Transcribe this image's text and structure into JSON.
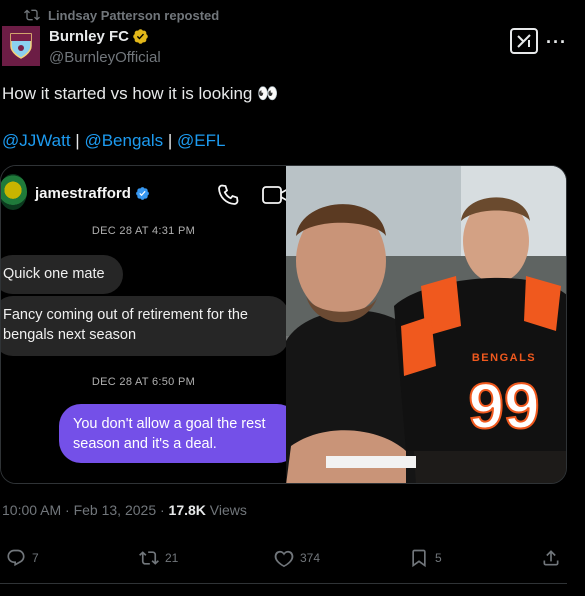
{
  "repost": {
    "text": "Lindsay Patterson reposted"
  },
  "author": {
    "name": "Burnley FC",
    "handle": "@BurnleyOfficial"
  },
  "tweet": {
    "text": "How it started vs how it is looking 👀",
    "mentions": [
      {
        "text": "@JJWatt"
      },
      {
        "sep": " | "
      },
      {
        "text": "@Bengals"
      },
      {
        "sep": " | "
      },
      {
        "text": "@EFL"
      }
    ]
  },
  "dm": {
    "username": "jamestrafford",
    "timestamp1": "DEC 28 AT 4:31 PM",
    "msg1": "Quick one mate",
    "msg2_line1": "Fancy coming out of retirement for the",
    "msg2_line2": "bengals next season",
    "timestamp2": "DEC 28 AT 6:50 PM",
    "msg3_line1": "You don't allow a goal the rest",
    "msg3_line2": "season and it's a deal."
  },
  "photo": {
    "jersey_text": "BENGALS",
    "jersey_number": "99"
  },
  "meta": {
    "time": "10:00 AM · Feb 13, 2025 · ",
    "views_count": "17.8K",
    "views_label": " Views"
  },
  "actions": {
    "replies": "7",
    "reposts": "21",
    "likes": "374",
    "bookmarks": "5"
  },
  "colors": {
    "link": "#1d9bf0",
    "verified_gold": "#e2b719",
    "dm_bubble_out": "#7450e8",
    "burnley_claret": "#6c1d45"
  }
}
